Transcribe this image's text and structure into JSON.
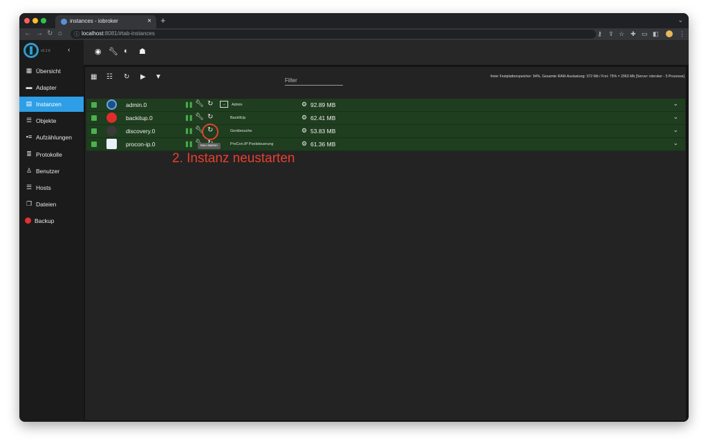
{
  "browser": {
    "tab_title": "instances - iobroker",
    "url_host": "localhost",
    "url_rest": ":8081/#tab-instances"
  },
  "sidebar": {
    "version": "v5.3.8",
    "items": [
      {
        "label": "Übersicht",
        "icon": "grid-icon"
      },
      {
        "label": "Adapter",
        "icon": "store-icon"
      },
      {
        "label": "Instanzen",
        "icon": "list-icon",
        "active": true
      },
      {
        "label": "Objekte",
        "icon": "list-icon"
      },
      {
        "label": "Aufzählungen",
        "icon": "list-icon"
      },
      {
        "label": "Protokolle",
        "icon": "doc-icon"
      },
      {
        "label": "Benutzer",
        "icon": "user-icon"
      },
      {
        "label": "Hosts",
        "icon": "host-icon"
      },
      {
        "label": "Dateien",
        "icon": "file-icon"
      },
      {
        "label": "Backup",
        "icon": "backup-icon"
      }
    ]
  },
  "panel": {
    "filter_label": "Filter",
    "status": "freier Festplattenspeicher: 94%, Gesamte RAM-Auslastung: 372 Mb / Frei: 75% = 2963 Mb [Server: iobroker - 5 Prozesse]"
  },
  "instances": [
    {
      "name": "admin.0",
      "title": "Admin",
      "memory": "92.89 MB",
      "icon_color": "#2a6fb8"
    },
    {
      "name": "backitup.0",
      "title": "BackItUp",
      "memory": "62.41 MB",
      "icon_color": "#e02c2c"
    },
    {
      "name": "discovery.0",
      "title": "Gerätesuche",
      "memory": "53.83 MB",
      "icon_color": "#777777"
    },
    {
      "name": "procon-ip.0",
      "title": "ProCon.IP Poolsteuerung",
      "memory": "61.36 MB",
      "icon_color": "#3a7fd0"
    }
  ],
  "tooltip": "Neu starten",
  "annotation": "2. Instanz neustarten"
}
